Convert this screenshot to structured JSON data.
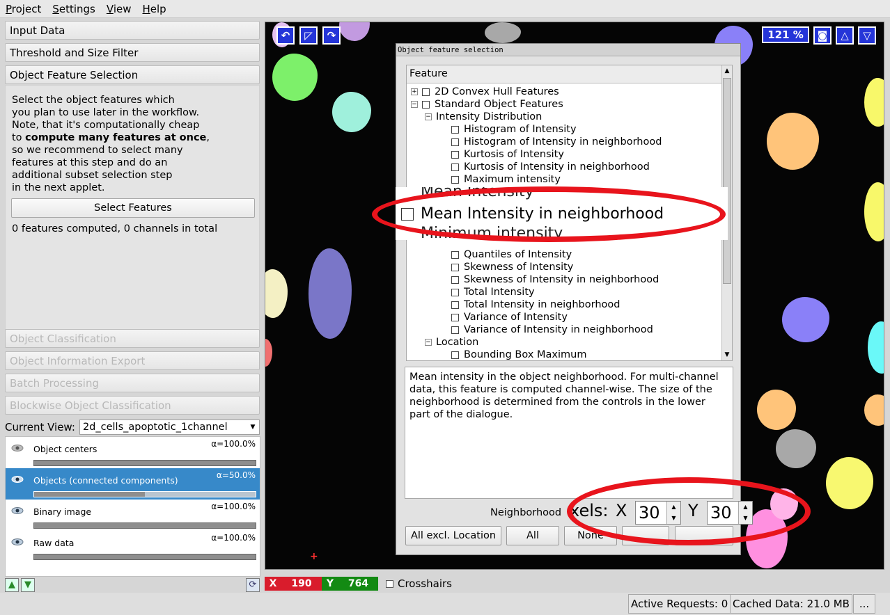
{
  "menu": [
    "Project",
    "Settings",
    "View",
    "Help"
  ],
  "applets": {
    "input_data": "Input Data",
    "threshold": "Threshold and Size Filter",
    "object_feature_selection": "Object Feature Selection",
    "object_classification": "Object Classification",
    "object_information_export": "Object Information Export",
    "batch_processing": "Batch Processing",
    "blockwise": "Blockwise Object Classification"
  },
  "applet_body": {
    "description_lines": [
      "Select the object features which",
      "you plan to use later in the workflow.",
      "Note, that it's computationally cheap",
      "to ",
      "compute many features at once",
      ",",
      "so we recommend to select many",
      "features at this step and do an",
      "additional subset selection step",
      "in the next applet."
    ],
    "select_button": "Select Features",
    "features_computed": "0 features computed, 0 channels in total"
  },
  "current_view": {
    "label": "Current View:",
    "value": "2d_cells_apoptotic_1channel"
  },
  "layers": [
    {
      "name": "Object centers",
      "alpha": "α=100.0%",
      "selected": false
    },
    {
      "name": "Objects (connected components)",
      "alpha": "α=50.0%",
      "selected": true,
      "opacity": 0.5
    },
    {
      "name": "Binary image",
      "alpha": "α=100.0%",
      "selected": false
    },
    {
      "name": "Raw data",
      "alpha": "α=100.0%",
      "selected": false
    }
  ],
  "viewer": {
    "zoom": "121 %"
  },
  "dialog": {
    "title": "Object feature selection",
    "tree_header": "Feature",
    "items": [
      {
        "label": "2D Convex Hull Features",
        "expander": "+"
      },
      {
        "label": "Standard Object Features",
        "expander": "−"
      },
      {
        "label": "Intensity Distribution",
        "expander": "−"
      },
      {
        "label": "Histogram of Intensity"
      },
      {
        "label": "Histogram of Intensity in neighborhood"
      },
      {
        "label": "Kurtosis of Intensity"
      },
      {
        "label": "Kurtosis of Intensity in neighborhood"
      },
      {
        "label": "Maximum intensity"
      },
      {
        "label": "Quantiles of Intensity"
      },
      {
        "label": "Skewness of Intensity"
      },
      {
        "label": "Skewness of Intensity in neighborhood"
      },
      {
        "label": "Total Intensity"
      },
      {
        "label": "Total Intensity in neighborhood"
      },
      {
        "label": "Variance of Intensity"
      },
      {
        "label": "Variance of Intensity in neighborhood"
      },
      {
        "label": "Location",
        "expander": "−"
      },
      {
        "label": "Bounding Box Maximum"
      }
    ],
    "zoomed_items": [
      "Mean Intensity",
      "Mean Intensity in neighborhood",
      "Minimum intensity"
    ],
    "description": "Mean intensity in the object neighborhood. For multi-channel data, this feature is computed channel-wise. The size of the neighborhood is determined from the controls in the lower part of the dialogue.",
    "neighborhood_label": "Neighborhood",
    "neighborhood_zoomed_label": "xels:",
    "x_label": "X",
    "x_value": "30",
    "y_label": "Y",
    "y_value": "30",
    "buttons": {
      "all_excl_location": "All excl. Location",
      "all": "All",
      "none": "None"
    }
  },
  "status": {
    "x_label": "X",
    "x_value": "190",
    "y_label": "Y",
    "y_value": "764",
    "crosshairs": "Crosshairs",
    "active_requests": "Active Requests: 0",
    "cached_data": "Cached Data: 21.0 MB",
    "more": "..."
  },
  "colors": {
    "selection": "#3789c9",
    "viewer_button": "#2535d8",
    "highlight": "#e8141c",
    "x_coord": "#d91c2c",
    "y_coord": "#138a13"
  }
}
